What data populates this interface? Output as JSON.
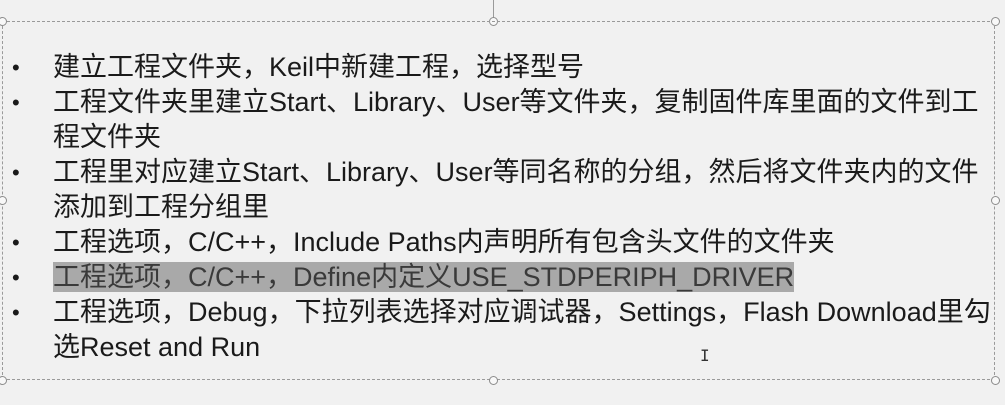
{
  "slide": {
    "bullet_symbol": "•",
    "bullets": [
      {
        "text": "建立工程文件夹，Keil中新建工程，选择型号"
      },
      {
        "text": "工程文件夹里建立Start、Library、User等文件夹，复制固件库里面的文件到工程文件夹"
      },
      {
        "text": "工程里对应建立Start、Library、User等同名称的分组，然后将文件夹内的文件添加到工程分组里"
      },
      {
        "text": "工程选项，C/C++，Include Paths内声明所有包含头文件的文件夹"
      },
      {
        "text": "工程选项，C/C++，Define内定义USE_STDPERIPH_DRIVER",
        "selected": true
      },
      {
        "text": "工程选项，Debug，下拉列表选择对应调试器，Settings，Flash Download里勾选Reset and Run"
      }
    ]
  },
  "cursor": {
    "glyph": "I"
  },
  "colors": {
    "background": "#f1f1f1",
    "text": "#1a1a1a",
    "selection": "#a9a9a9"
  }
}
